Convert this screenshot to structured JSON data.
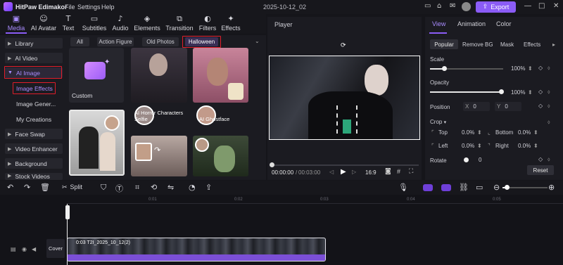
{
  "app": {
    "title": "HitPaw Edimakor",
    "menus": [
      "File",
      "Settings",
      "Help"
    ],
    "date": "2025-10-12_02",
    "export": "Export"
  },
  "toolbar": [
    {
      "label": "Media",
      "icon": "media-icon",
      "glyph": "▣"
    },
    {
      "label": "AI Avatar",
      "icon": "ai-avatar-icon",
      "glyph": "☺"
    },
    {
      "label": "Text",
      "icon": "text-icon",
      "glyph": "T"
    },
    {
      "label": "Subtitles",
      "icon": "subtitles-icon",
      "glyph": "▭"
    },
    {
      "label": "Audio",
      "icon": "audio-icon",
      "glyph": "♪"
    },
    {
      "label": "Elements",
      "icon": "elements-icon",
      "glyph": "◈"
    },
    {
      "label": "Transition",
      "icon": "transition-icon",
      "glyph": "⧉"
    },
    {
      "label": "Filters",
      "icon": "filters-icon",
      "glyph": "◐"
    },
    {
      "label": "Effects",
      "icon": "effects-icon",
      "glyph": "✦"
    }
  ],
  "sidebar": [
    "Library",
    "AI Video",
    "AI Image",
    "Image Effects",
    "Image Gener...",
    "My Creations",
    "Face Swap",
    "Video Enhancer",
    "Background",
    "Stock Videos"
  ],
  "media": {
    "chips": [
      "All",
      "Action Figure",
      "Old Photos",
      "Halloween"
    ],
    "custom": "Custom",
    "tile1": "AI Horror Characters Selfie",
    "tile2": "AI Ghostface"
  },
  "player": {
    "title": "Player",
    "time_current": "00:00:00",
    "time_total": "00:03:00",
    "ratio": "16:9"
  },
  "props": {
    "tabs": [
      "View",
      "Animation",
      "Color"
    ],
    "subtabs": [
      "Popular",
      "Remove BG",
      "Mask",
      "Effects"
    ],
    "scale_label": "Scale",
    "scale_value": "100%",
    "scale_fraction": 1.0,
    "opacity_label": "Opacity",
    "opacity_value": "100%",
    "opacity_fraction": 1.0,
    "position_label": "Position",
    "pos_x_label": "X",
    "pos_x": "0",
    "pos_y_label": "Y",
    "pos_y": "0",
    "crop_label": "Crop",
    "crop_top_label": "Top",
    "crop_top": "0.0%",
    "crop_bottom_label": "Bottom",
    "crop_bottom": "0.0%",
    "crop_left_label": "Left",
    "crop_left": "0.0%",
    "crop_right_label": "Right",
    "crop_right": "0.0%",
    "rotate_label": "Rotate",
    "rotate_value": "0",
    "reset": "Reset"
  },
  "timeline": {
    "split": "Split",
    "ticks": [
      "0:01",
      "0:02",
      "0:03",
      "0:04",
      "0:05"
    ],
    "cover": "Cover",
    "clip_label": "0:03  T2I_2025_10_12(2)"
  },
  "colors": {
    "accent": "#8b5cf6",
    "red": "#e11d2a",
    "purple": "#7b4fd6"
  }
}
